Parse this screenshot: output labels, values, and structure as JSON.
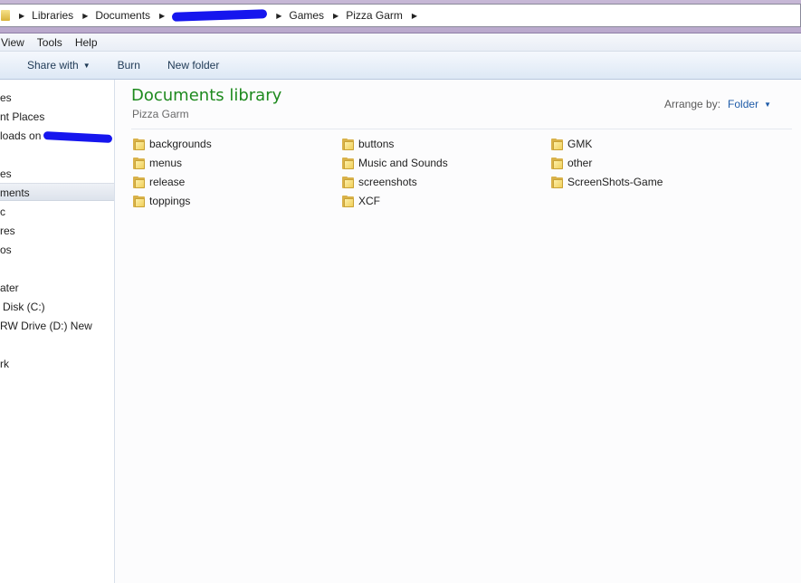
{
  "address_bar": {
    "crumbs": [
      "Libraries",
      "Documents",
      "Games",
      "Pizza Garm"
    ]
  },
  "menu": {
    "items": [
      "View",
      "Tools",
      "Help"
    ]
  },
  "toolbar": {
    "share_with": "Share with",
    "burn": "Burn",
    "new_folder": "New folder"
  },
  "nav": {
    "items": [
      "es",
      "nt Places",
      "loads on",
      "es",
      "ments",
      "c",
      "res",
      "os",
      "ater",
      "Disk (C:)",
      "RW Drive (D:) New",
      "rk"
    ]
  },
  "content": {
    "title": "Documents library",
    "subtitle": "Pizza Garm",
    "arrange_label": "Arrange by:",
    "arrange_value": "Folder",
    "folders": [
      "backgrounds",
      "menus",
      "release",
      "toppings",
      "buttons",
      "Music and Sounds",
      "screenshots",
      "XCF",
      "GMK",
      "other",
      "ScreenShots-Game"
    ]
  },
  "colors": {
    "title_green": "#1e8a1e",
    "link_blue": "#1e5ba8",
    "redaction": "#1616ee"
  }
}
